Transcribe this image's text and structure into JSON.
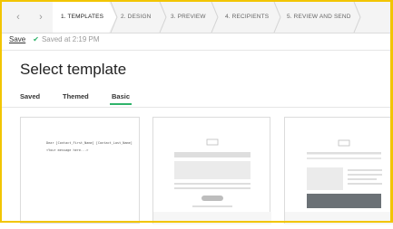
{
  "steps": {
    "prev_icon": "chevron-left-icon",
    "next_icon": "chevron-right-icon",
    "items": [
      {
        "label": "1. TEMPLATES",
        "active": true
      },
      {
        "label": "2. DESIGN",
        "active": false
      },
      {
        "label": "3. PREVIEW",
        "active": false
      },
      {
        "label": "4. RECIPIENTS",
        "active": false
      },
      {
        "label": "5. REVIEW AND SEND",
        "active": false
      }
    ]
  },
  "status": {
    "save_label": "Save",
    "saved_text": "Saved at 2:19 PM",
    "check_icon": "check-icon"
  },
  "page": {
    "title": "Select template"
  },
  "tabs": [
    {
      "label": "Saved",
      "active": false
    },
    {
      "label": "Themed",
      "active": false
    },
    {
      "label": "Basic",
      "active": true
    }
  ],
  "templates": [
    {
      "kind": "plain-text",
      "lines": [
        "Dear [Contact_First_Name] [Contact_Last_Name]",
        "<Your message here...>"
      ]
    },
    {
      "kind": "centered-layout"
    },
    {
      "kind": "side-image-layout"
    }
  ],
  "colors": {
    "accent": "#2fb36a",
    "frame": "#f2c500",
    "steps_bg": "#f4f4f4"
  }
}
